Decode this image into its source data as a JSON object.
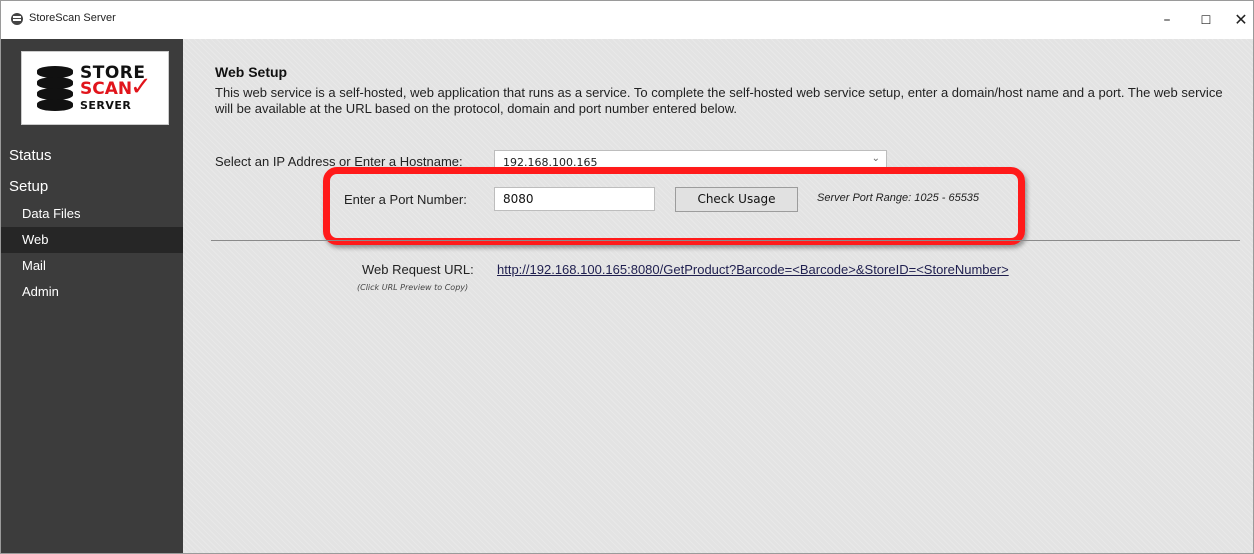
{
  "window": {
    "title": "StoreScan Server",
    "min_glyph": "–",
    "max_glyph": "☐",
    "close_glyph": "✕"
  },
  "logo": {
    "store": "STORE",
    "scan": "SCAN",
    "server": "SERVER",
    "check_glyph": "✓",
    "brand_red": "#e1141b"
  },
  "sidebar": {
    "status": "Status",
    "setup": "Setup",
    "items": [
      {
        "label": "Data Files"
      },
      {
        "label": "Web"
      },
      {
        "label": "Mail"
      },
      {
        "label": "Admin"
      }
    ],
    "active_item": "Web"
  },
  "main": {
    "title": "Web Setup",
    "description": "This web service is a self-hosted, web application that runs as a service.  To complete the self-hosted web service setup, enter a domain/host name and a port. The web service will be available at the URL based on the protocol, domain and port number entered below.",
    "ip_label": "Select an IP Address or Enter a Hostname:",
    "ip_value": "192.168.100.165",
    "port_label": "Enter a Port Number:",
    "port_value": "8080",
    "check_button": "Check Usage",
    "port_range": "Server Port Range: 1025 - 65535",
    "url_label": "Web Request URL:",
    "url_hint": "(Click URL Preview to Copy)",
    "url": "http://192.168.100.165:8080/GetProduct?Barcode=<Barcode>&StoreID=<StoreNumber>"
  },
  "colors": {
    "sidebar_bg": "#3c3c3c",
    "active_item_bg": "#262626",
    "highlight": "#ff1a1a"
  }
}
